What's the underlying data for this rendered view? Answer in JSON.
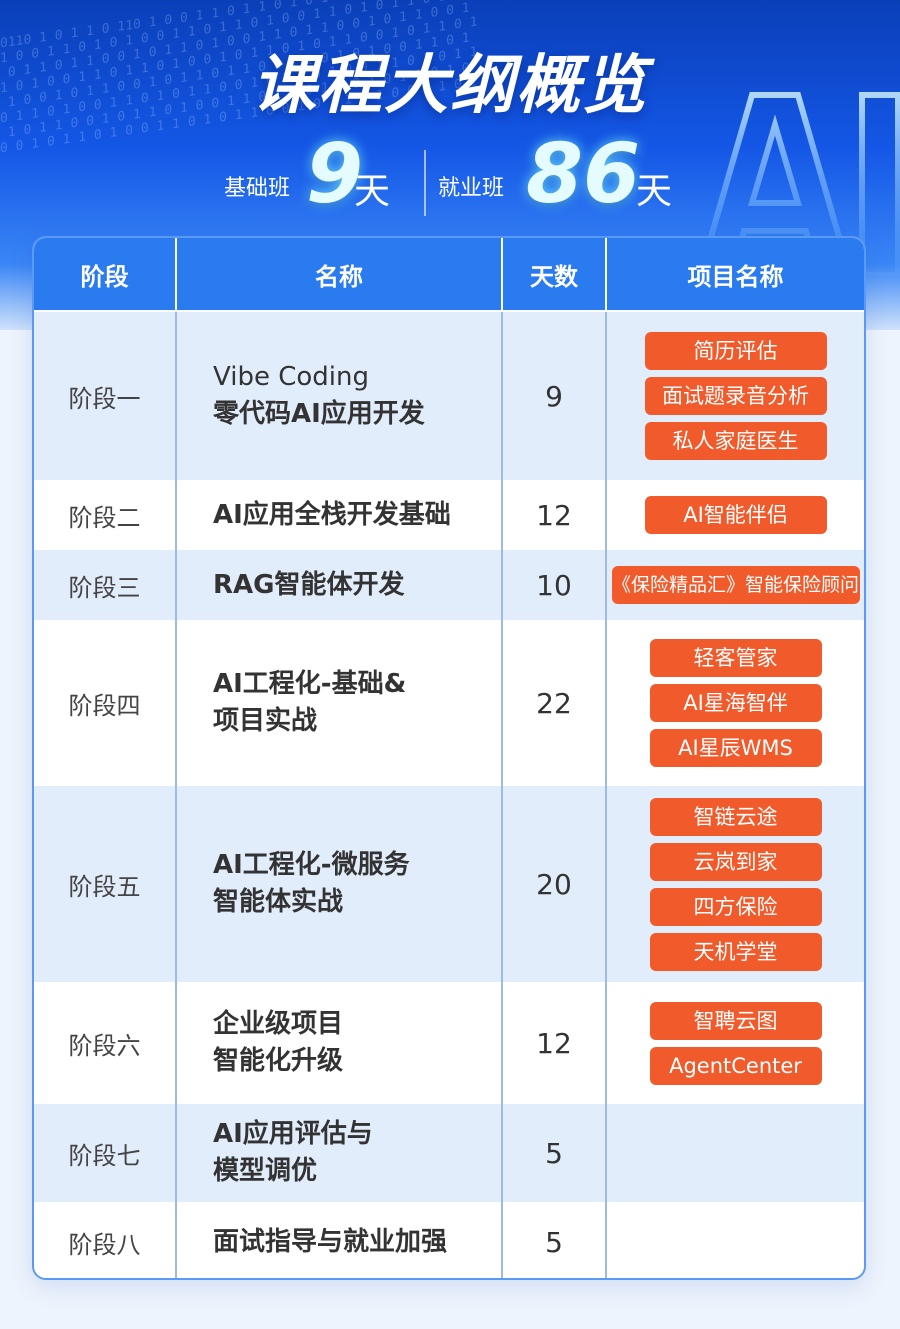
{
  "header": {
    "title": "课程大纲概览",
    "basic": {
      "label": "基础班",
      "number": "9",
      "unit": "天"
    },
    "employment": {
      "label": "就业班",
      "number": "86",
      "unit": "天"
    },
    "decor_text": "AI"
  },
  "table": {
    "headers": [
      "阶段",
      "名称",
      "天数",
      "项目名称"
    ],
    "rows": [
      {
        "stage": "阶段一",
        "name_line1": "Vibe Coding",
        "name_line2": "零代码AI应用开发",
        "days": "9",
        "projects": [
          "简历评估",
          "面试题录音分析",
          "私人家庭医生"
        ]
      },
      {
        "stage": "阶段二",
        "name_line1": "AI应用全栈开发基础",
        "name_line2": "",
        "days": "12",
        "projects": [
          "AI智能伴侣"
        ]
      },
      {
        "stage": "阶段三",
        "name_line1": "RAG智能体开发",
        "name_line2": "",
        "days": "10",
        "projects": [
          "《保险精品汇》智能保险顾问"
        ]
      },
      {
        "stage": "阶段四",
        "name_line1": "AI工程化-基础&",
        "name_line2": "项目实战",
        "days": "22",
        "projects": [
          "轻客管家",
          "AI星海智伴",
          "AI星辰WMS"
        ]
      },
      {
        "stage": "阶段五",
        "name_line1": "AI工程化-微服务",
        "name_line2": "智能体实战",
        "days": "20",
        "projects": [
          "智链云途",
          "云岚到家",
          "四方保险",
          "天机学堂"
        ]
      },
      {
        "stage": "阶段六",
        "name_line1": "企业级项目",
        "name_line2": "智能化升级",
        "days": "12",
        "projects": [
          "智聘云图",
          "AgentCenter"
        ]
      },
      {
        "stage": "阶段七",
        "name_line1": "AI应用评估与",
        "name_line2": "模型调优",
        "days": "5",
        "projects": []
      },
      {
        "stage": "阶段八",
        "name_line1": "面试指导与就业加强",
        "name_line2": "",
        "days": "5",
        "projects": []
      }
    ]
  },
  "colors": {
    "header_bg": "#2a7af0",
    "row_alt": "#e2edfc",
    "tag": "#f15a2b",
    "hero_top": "#0a3fb8"
  }
}
